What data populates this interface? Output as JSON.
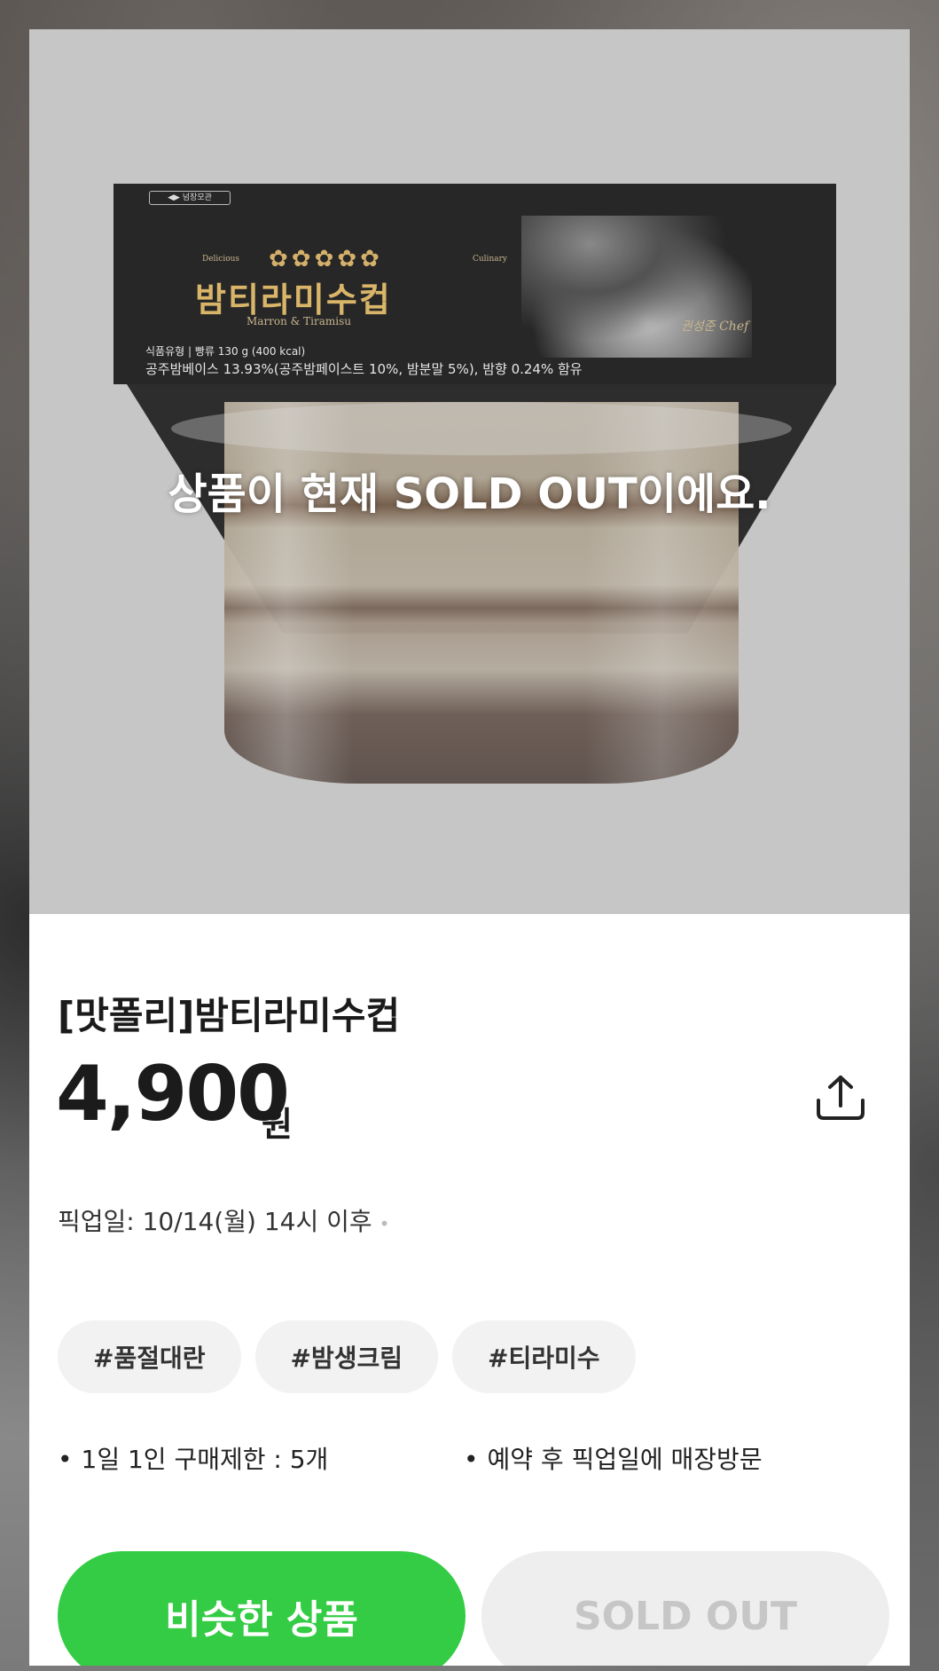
{
  "hero": {
    "overlay_text": "상품이 현재 SOLD OUT이에요.",
    "label": {
      "brand": "◀▶ 넘장모관",
      "deco_left": "Delicious",
      "deco_right": "Culinary",
      "flowers": "✿✿✿✿✿",
      "title": "밤티라미수컵",
      "subtitle": "Marron & Tiramisu",
      "info_line1": "식품유형 | 빵류   130 g (400 kcal)",
      "info_line2": "공주밤베이스 13.93%(공주밤페이스트 10%, 밤분말 5%), 밤향 0.24% 함유",
      "signature": "권성준 Chef"
    }
  },
  "product": {
    "title": "[맛폴리]밤티라미수컵",
    "price": "4,900",
    "price_unit": "원",
    "pickup": "픽업일: 10/14(월) 14시 이후",
    "pickup_dot": "•"
  },
  "tags": [
    "#품절대란",
    "#밤생크림",
    "#티라미수"
  ],
  "notes": {
    "bullet": "•",
    "limit": "1일 1인 구매제한 : 5개",
    "visit": "예약 후 픽업일에 매장방문"
  },
  "buttons": {
    "similar": "비슷한 상품",
    "sold_out": "SOLD OUT"
  },
  "icons": {
    "share": "share-icon"
  },
  "colors": {
    "accent_green": "#33CC44",
    "disabled_bg": "#EEEEEE",
    "disabled_text": "#C6C6C6"
  }
}
